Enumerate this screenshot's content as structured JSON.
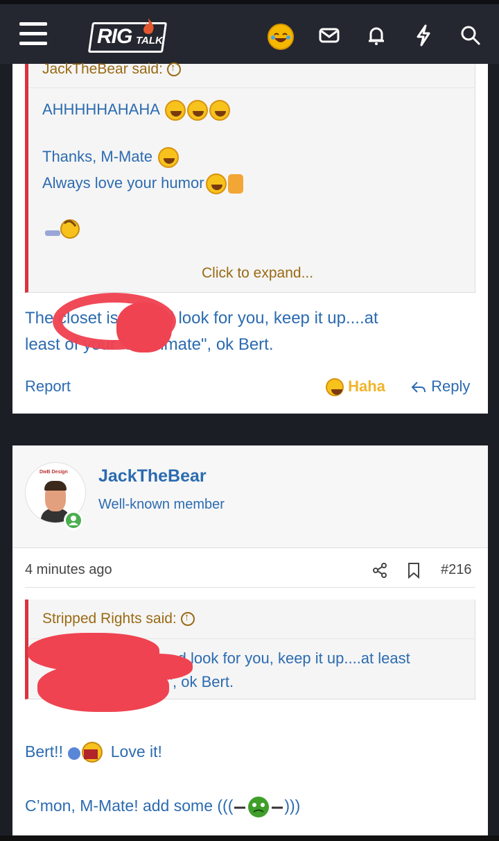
{
  "header": {
    "logo_main": "RIG",
    "logo_sub": "TALK",
    "icons": [
      "menu-icon",
      "laughing-emoji-icon",
      "mail-icon",
      "bell-icon",
      "bolt-icon",
      "search-icon"
    ]
  },
  "post1": {
    "quote_author": "JackTheBear said:",
    "quote_line1": "AHHHHHAHAHA",
    "quote_line2": "Thanks, M-Mate",
    "quote_line3": "Always love your humor",
    "expand": "Click to expand...",
    "body_line1": "The closet is a good look for you, keep it up....at",
    "body_line2": "least of your \"roommate\", ok Bert.",
    "report": "Report",
    "reaction": "Haha",
    "reply": "Reply"
  },
  "post2": {
    "username": "JackTheBear",
    "user_title": "Well-known member",
    "avatar_caption": "DwB Design",
    "time": "4 minutes ago",
    "post_number": "#216",
    "quote_author": "Stripped Rights said:",
    "quote_line1": "The closest is a good look for you, keep it up....at least",
    "quote_line2": "of your \"roommate\", ok Bert.",
    "body_line1_a": "Bert!!",
    "body_line1_b": "Love it!",
    "body_line2_a": "C’mon, M-Mate! add some (((",
    "body_line2_b": ")))"
  },
  "colors": {
    "accent": "#2c6bb0",
    "quote_bar": "#d9343e",
    "scribble": "#ef4351",
    "quote_author": "#9a6a14",
    "header_bg": "#24272f"
  }
}
